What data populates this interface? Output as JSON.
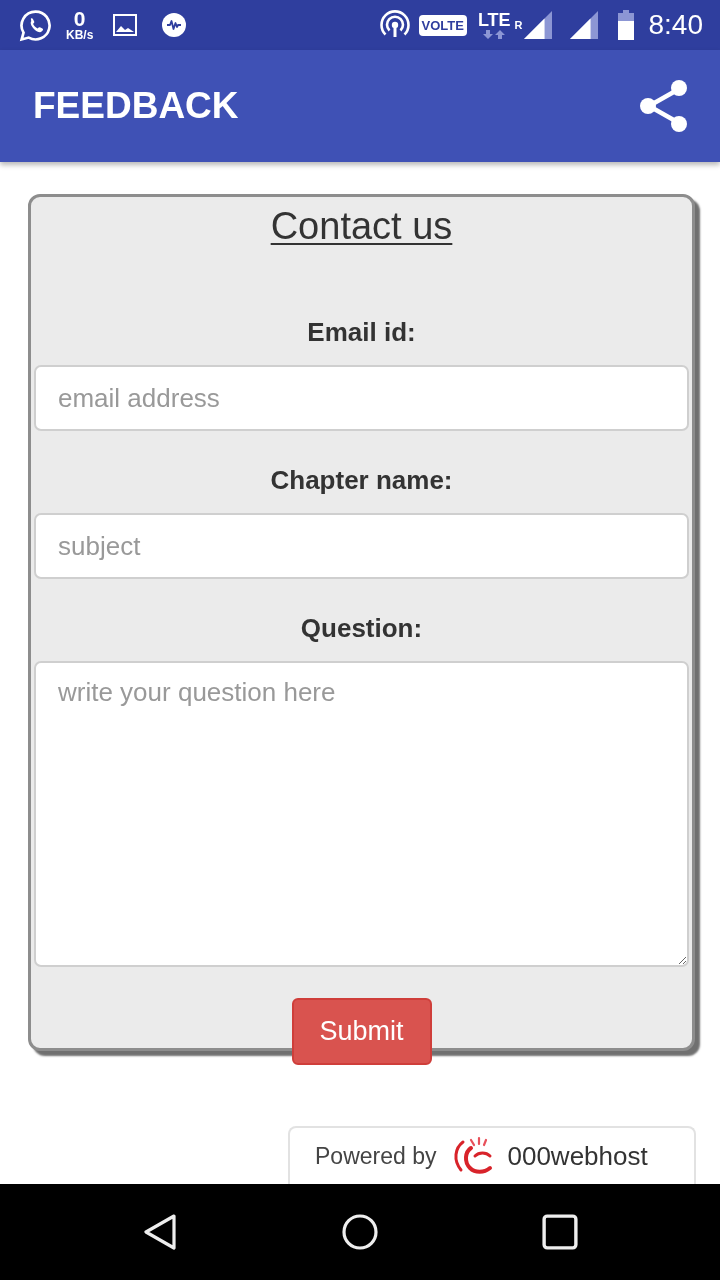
{
  "status_bar": {
    "network_speed": "0",
    "speed_unit": "KB/s",
    "network_badge": "VOLTE",
    "data_type": "LTE",
    "roaming": "R",
    "time": "8:40"
  },
  "app_bar": {
    "title": "FEEDBACK"
  },
  "form": {
    "title": "Contact us",
    "fields": [
      {
        "kind": "input",
        "label": "Email id:",
        "placeholder": "email address"
      },
      {
        "kind": "input",
        "label": "Chapter name:",
        "placeholder": "subject"
      },
      {
        "kind": "textarea",
        "label": "Question:",
        "placeholder": "write your question here"
      }
    ],
    "submit": "Submit"
  },
  "footer_badge": {
    "prefix": "Powered by",
    "brand": "000webhost"
  }
}
